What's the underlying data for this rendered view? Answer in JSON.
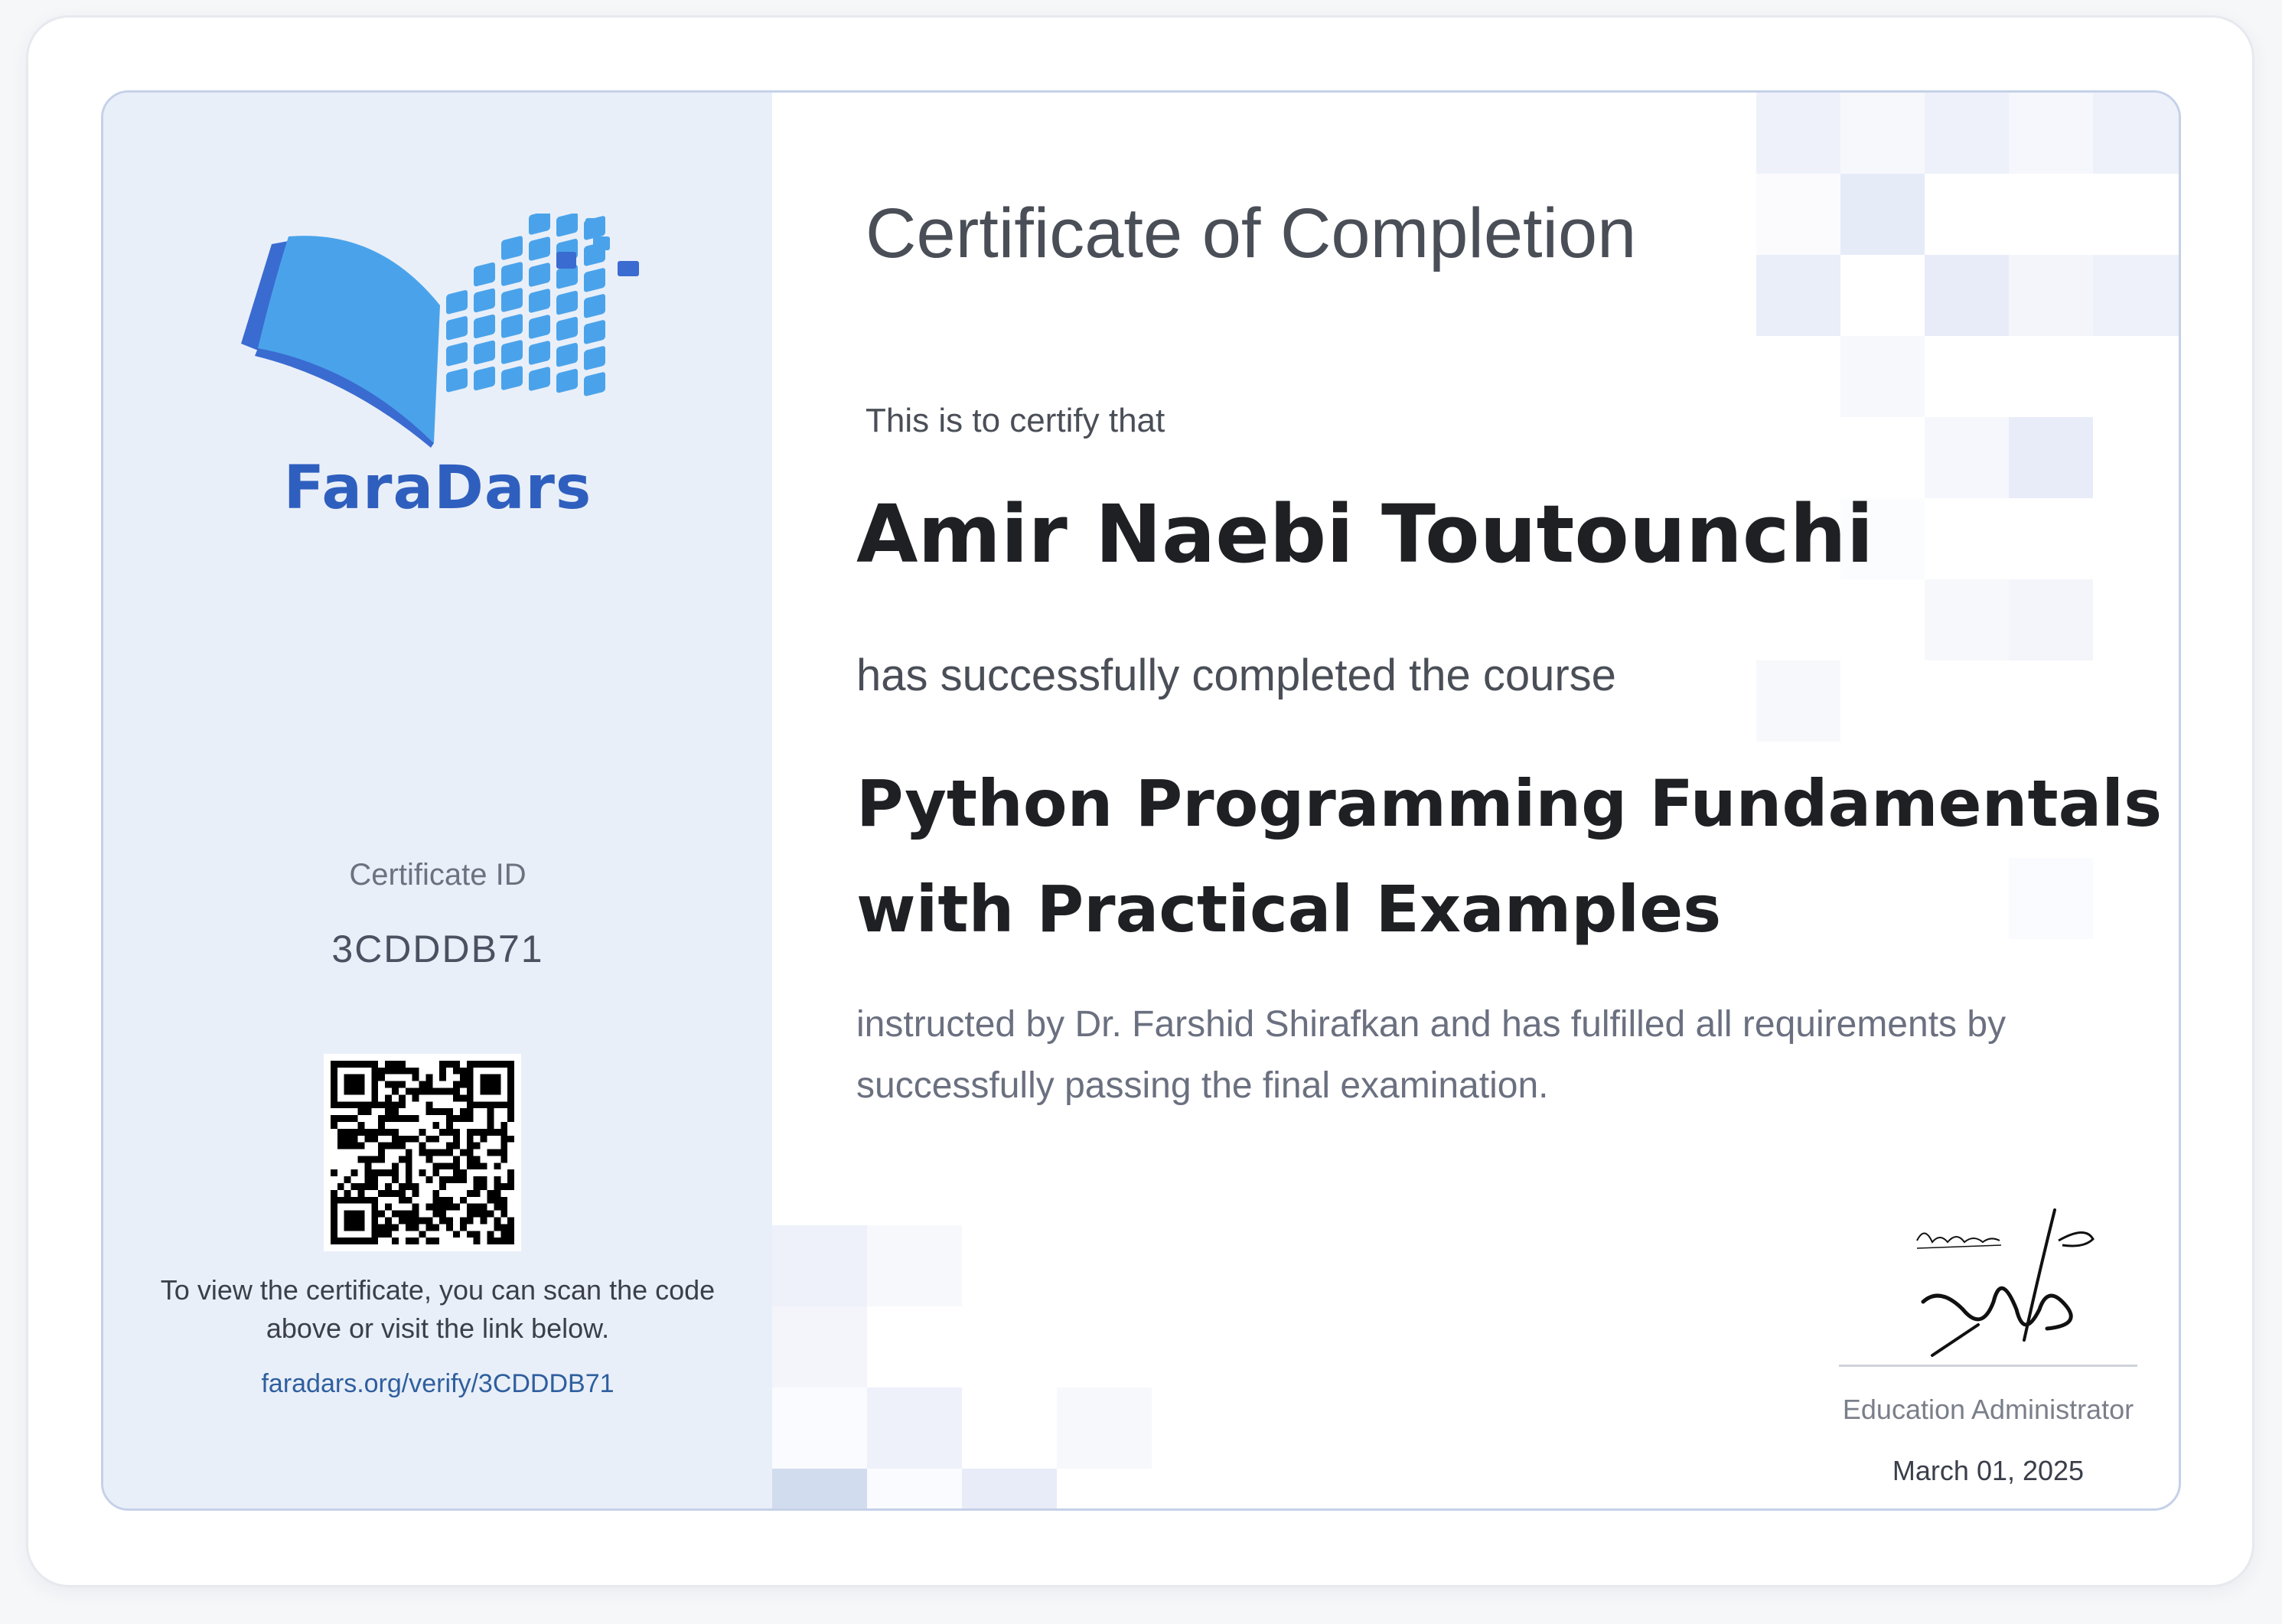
{
  "certificate": {
    "brand_name": "FaraDars",
    "title": "Certificate of Completion",
    "certify_text": "This is to certify that",
    "recipient_name": "Amir Naebi Toutounchi",
    "completed_text": "has successfully completed the course",
    "course_title": "Python Programming Fundamentals with Practical Examples",
    "instructed_text": "instructed by Dr. Farshid Shirafkan and has fulfilled all requirements by successfully passing the final examination.",
    "certificate_id_label": "Certificate ID",
    "certificate_id": "3CDDDB71",
    "scan_text": "To view the certificate, you can scan the code above or visit the link below.",
    "verify_link": "faradars.org/verify/3CDDDB71",
    "signer_role": "Education Administrator",
    "date": "March 01, 2025"
  },
  "colors": {
    "brand_blue": "#2f5fbe",
    "logo_light": "#4aa3ea",
    "logo_dark": "#3a6bd0",
    "panel_bg": "#e9eff9",
    "border": "#c5d1e8",
    "link": "#2f5f9e"
  },
  "icons": {
    "logo": "open-book-pixel-logo",
    "qr": "qr-code",
    "signature": "handwritten-signature"
  }
}
